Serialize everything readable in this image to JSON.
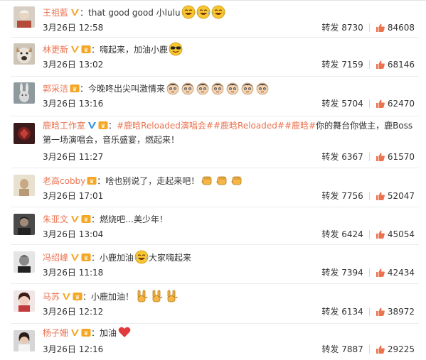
{
  "comments": [
    {
      "avatar": "avatar-elderly-woman",
      "user": "王祖藍",
      "badges": [
        "v"
      ],
      "text": "：that good good 小lulu",
      "emoji": [
        "laughing-tears-emoji",
        "laughing-tears-emoji",
        "laughing-tears-emoji"
      ],
      "time": "3月26日 12:58",
      "repost_label": "转发",
      "repost_count": "8730",
      "likes": "84608"
    },
    {
      "avatar": "avatar-dog",
      "user": "林更新",
      "badges": [
        "v",
        "vip"
      ],
      "text": "：嗨起来，加油小鹿",
      "emoji": [
        "sunglasses-emoji"
      ],
      "time": "3月26日 13:02",
      "repost_label": "转发",
      "repost_count": "7159",
      "likes": "68146"
    },
    {
      "avatar": "avatar-rabbit",
      "user": "郭采洁",
      "badges": [
        "vip"
      ],
      "text": "：今晚咚出尖叫激情来",
      "emoji": [
        "boy-face-emoji",
        "boy-face-emoji",
        "boy-face-emoji",
        "boy-face-emoji",
        "boy-face-emoji",
        "boy-face-emoji",
        "boy-face-emoji"
      ],
      "time": "3月26日 13:16",
      "repost_label": "转发",
      "repost_count": "5704",
      "likes": "62470"
    },
    {
      "avatar": "avatar-studio-logo",
      "user": "鹿晗工作室",
      "badges": [
        "v-blue",
        "vip"
      ],
      "text_prefix": "：",
      "topics": [
        "#鹿晗Reloaded演唱会#",
        "#鹿晗Reloaded#",
        "#鹿晗#"
      ],
      "text": "你的舞台你做主，鹿Boss第一场演唱会，音乐盛宴，燃起来！",
      "time": "3月26日 11:27",
      "repost_label": "转发",
      "repost_count": "6367",
      "likes": "61570"
    },
    {
      "avatar": "avatar-man-beige",
      "user": "老高cobby",
      "badges": [
        "vip"
      ],
      "text": "：啥也别说了，走起来吧！",
      "emoji": [
        "fist-emoji",
        "fist-emoji",
        "fist-emoji"
      ],
      "time": "3月26日 17:01",
      "repost_label": "转发",
      "repost_count": "7756",
      "likes": "52047"
    },
    {
      "avatar": "avatar-man-dark",
      "user": "朱亚文",
      "badges": [
        "v",
        "vip"
      ],
      "text": "：燃烧吧…美少年！",
      "emoji": [],
      "time": "3月26日 13:04",
      "repost_label": "转发",
      "repost_count": "6424",
      "likes": "45054"
    },
    {
      "avatar": "avatar-man-bw",
      "user": "冯绍峰",
      "badges": [
        "v",
        "vip"
      ],
      "text": "：小鹿加油",
      "emoji": [
        "laughing-tears-emoji"
      ],
      "text_after": "大家嗨起来",
      "time": "3月26日 11:18",
      "repost_label": "转发",
      "repost_count": "7394",
      "likes": "42434"
    },
    {
      "avatar": "avatar-woman-cartoon",
      "user": "马苏",
      "badges": [
        "v",
        "vip"
      ],
      "text": "：小鹿加油！",
      "emoji": [
        "rock-hand-emoji",
        "rock-hand-emoji",
        "rock-hand-emoji"
      ],
      "time": "3月26日 12:12",
      "repost_label": "转发",
      "repost_count": "6134",
      "likes": "38972"
    },
    {
      "avatar": "avatar-woman",
      "user": "杨子姗",
      "badges": [
        "v",
        "vip"
      ],
      "text": "：加油",
      "emoji": [
        "heart-emoji"
      ],
      "time": "3月26日 12:16",
      "repost_label": "转发",
      "repost_count": "7887",
      "likes": "29225"
    }
  ],
  "colors": {
    "username": "#eb7350",
    "topic": "#eb7350",
    "text": "#333333",
    "verified_gold": "#f5a623",
    "verified_blue": "#2d8ce6",
    "like": "#eb7350"
  }
}
